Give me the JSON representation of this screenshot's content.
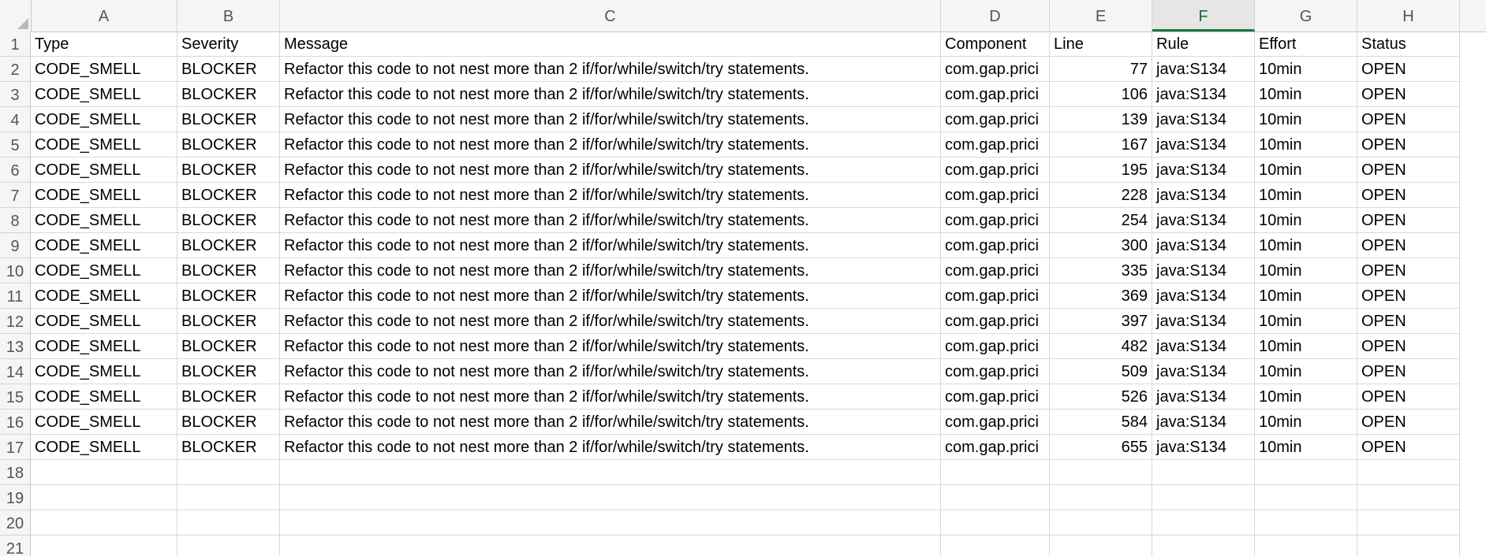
{
  "columns": [
    "A",
    "B",
    "C",
    "D",
    "E",
    "F",
    "G",
    "H"
  ],
  "selected_column": "F",
  "row_numbers": [
    "1",
    "2",
    "3",
    "4",
    "5",
    "6",
    "7",
    "8",
    "9",
    "10",
    "11",
    "12",
    "13",
    "14",
    "15",
    "16",
    "17",
    "18",
    "19",
    "20",
    "21"
  ],
  "header": [
    "Type",
    "Severity",
    "Message",
    "Component",
    "Line",
    "Rule",
    "Effort",
    "Status"
  ],
  "rows": [
    [
      "CODE_SMELL",
      "BLOCKER",
      "Refactor this code to not nest more than 2 if/for/while/switch/try statements.",
      "com.gap.prici",
      "77",
      "java:S134",
      "10min",
      "OPEN"
    ],
    [
      "CODE_SMELL",
      "BLOCKER",
      "Refactor this code to not nest more than 2 if/for/while/switch/try statements.",
      "com.gap.prici",
      "106",
      "java:S134",
      "10min",
      "OPEN"
    ],
    [
      "CODE_SMELL",
      "BLOCKER",
      "Refactor this code to not nest more than 2 if/for/while/switch/try statements.",
      "com.gap.prici",
      "139",
      "java:S134",
      "10min",
      "OPEN"
    ],
    [
      "CODE_SMELL",
      "BLOCKER",
      "Refactor this code to not nest more than 2 if/for/while/switch/try statements.",
      "com.gap.prici",
      "167",
      "java:S134",
      "10min",
      "OPEN"
    ],
    [
      "CODE_SMELL",
      "BLOCKER",
      "Refactor this code to not nest more than 2 if/for/while/switch/try statements.",
      "com.gap.prici",
      "195",
      "java:S134",
      "10min",
      "OPEN"
    ],
    [
      "CODE_SMELL",
      "BLOCKER",
      "Refactor this code to not nest more than 2 if/for/while/switch/try statements.",
      "com.gap.prici",
      "228",
      "java:S134",
      "10min",
      "OPEN"
    ],
    [
      "CODE_SMELL",
      "BLOCKER",
      "Refactor this code to not nest more than 2 if/for/while/switch/try statements.",
      "com.gap.prici",
      "254",
      "java:S134",
      "10min",
      "OPEN"
    ],
    [
      "CODE_SMELL",
      "BLOCKER",
      "Refactor this code to not nest more than 2 if/for/while/switch/try statements.",
      "com.gap.prici",
      "300",
      "java:S134",
      "10min",
      "OPEN"
    ],
    [
      "CODE_SMELL",
      "BLOCKER",
      "Refactor this code to not nest more than 2 if/for/while/switch/try statements.",
      "com.gap.prici",
      "335",
      "java:S134",
      "10min",
      "OPEN"
    ],
    [
      "CODE_SMELL",
      "BLOCKER",
      "Refactor this code to not nest more than 2 if/for/while/switch/try statements.",
      "com.gap.prici",
      "369",
      "java:S134",
      "10min",
      "OPEN"
    ],
    [
      "CODE_SMELL",
      "BLOCKER",
      "Refactor this code to not nest more than 2 if/for/while/switch/try statements.",
      "com.gap.prici",
      "397",
      "java:S134",
      "10min",
      "OPEN"
    ],
    [
      "CODE_SMELL",
      "BLOCKER",
      "Refactor this code to not nest more than 2 if/for/while/switch/try statements.",
      "com.gap.prici",
      "482",
      "java:S134",
      "10min",
      "OPEN"
    ],
    [
      "CODE_SMELL",
      "BLOCKER",
      "Refactor this code to not nest more than 2 if/for/while/switch/try statements.",
      "com.gap.prici",
      "509",
      "java:S134",
      "10min",
      "OPEN"
    ],
    [
      "CODE_SMELL",
      "BLOCKER",
      "Refactor this code to not nest more than 2 if/for/while/switch/try statements.",
      "com.gap.prici",
      "526",
      "java:S134",
      "10min",
      "OPEN"
    ],
    [
      "CODE_SMELL",
      "BLOCKER",
      "Refactor this code to not nest more than 2 if/for/while/switch/try statements.",
      "com.gap.prici",
      "584",
      "java:S134",
      "10min",
      "OPEN"
    ],
    [
      "CODE_SMELL",
      "BLOCKER",
      "Refactor this code to not nest more than 2 if/for/while/switch/try statements.",
      "com.gap.prici",
      "655",
      "java:S134",
      "10min",
      "OPEN"
    ]
  ],
  "colors": {
    "accent": "#217346",
    "header_bg": "#f5f5f5",
    "gridline": "#d9d9d9"
  }
}
